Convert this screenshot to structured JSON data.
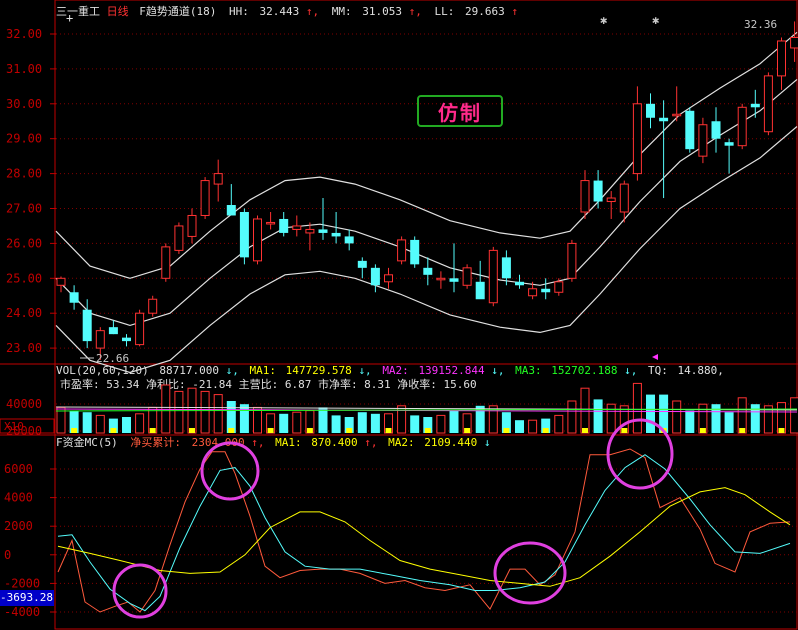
{
  "header": {
    "stock": "三一重工",
    "period": "日线",
    "indicator": "F趋势通道(18)",
    "hh_label": "HH:",
    "hh_value": "32.443",
    "mm_label": "MM:",
    "mm_value": "31.053",
    "ll_label": "LL:",
    "ll_value": "29.663"
  },
  "main_chart": {
    "y_ticks": [
      "32.00",
      "31.00",
      "30.00",
      "29.00",
      "28.00",
      "27.00",
      "26.00",
      "25.00",
      "24.00",
      "23.00"
    ],
    "high_label": "32.36",
    "low_label": "22.66",
    "watermark": "仿制"
  },
  "vol_panel": {
    "params": "VOL(20,60,120)",
    "vol_value": "88717.000",
    "ma1_label": "MA1:",
    "ma1_value": "147729.578",
    "ma2_label": "MA2:",
    "ma2_value": "139152.844",
    "ma3_label": "MA3:",
    "ma3_value": "152702.188",
    "tq_label": "TQ:",
    "tq_value": "14.880,",
    "fin_line": "市盈率: 53.34 净利比: -21.84 主营比: 6.87 市净率: 8.31 净收率: 15.60",
    "y_ticks": [
      "40000",
      "20000"
    ],
    "unit": "X10"
  },
  "fund_panel": {
    "title": "F资金MC(5)",
    "net_label": "净买累计:",
    "net_value": "2304.000",
    "ma1_label": "MA1:",
    "ma1_value": "870.400",
    "ma2_label": "MA2:",
    "ma2_value": "2109.440",
    "y_ticks": [
      "6000",
      "4000",
      "2000",
      "0",
      "-2000",
      "-4000"
    ],
    "current_value": "-3693.28"
  },
  "colors": {
    "up": "#ff3232",
    "down": "#54fcfc",
    "grid": "#800000",
    "axis": "#c00000",
    "yellow": "#ffff00",
    "pink": "#ff33ff",
    "white": "#e0e0e0"
  }
}
